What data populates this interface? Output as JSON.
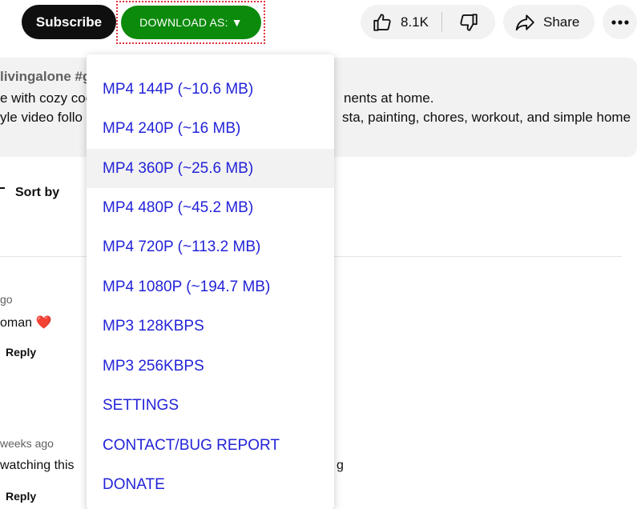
{
  "actions": {
    "subscribe_label": "Subscribe",
    "download_label": "DOWNLOAD AS: ▼",
    "like_count": "8.1K",
    "share_label": "Share"
  },
  "description": {
    "tags": "livingalone #gl",
    "line1_left": "e with cozy coo",
    "line1_right": "nents at home.",
    "line2_left": "yle video follo",
    "line2_right": "sta, painting, chores, workout, and simple home"
  },
  "sort": {
    "label": "Sort by"
  },
  "comments": [
    {
      "time": "go",
      "text": "oman",
      "emoji": "❤️",
      "reply": "Reply"
    },
    {
      "time": "weeks ago",
      "text_left": "watching this",
      "text_right": "g",
      "reply": "Reply"
    }
  ],
  "download_menu": {
    "items": [
      {
        "label": "MP4 144P (~10.6 MB)"
      },
      {
        "label": "MP4 240P (~16 MB)"
      },
      {
        "label": "MP4 360P (~25.6 MB)",
        "hovered": true
      },
      {
        "label": "MP4 480P (~45.2 MB)"
      },
      {
        "label": "MP4 720P (~113.2 MB)"
      },
      {
        "label": "MP4 1080P (~194.7 MB)"
      },
      {
        "label": "MP3 128KBPS"
      },
      {
        "label": "MP3 256KBPS"
      },
      {
        "label": "SETTINGS"
      },
      {
        "label": "CONTACT/BUG REPORT"
      },
      {
        "label": "DONATE"
      }
    ]
  },
  "colors": {
    "download_green": "#0c8a0c",
    "menu_link_blue": "#2323d8",
    "highlight_border": "#e0303a"
  }
}
